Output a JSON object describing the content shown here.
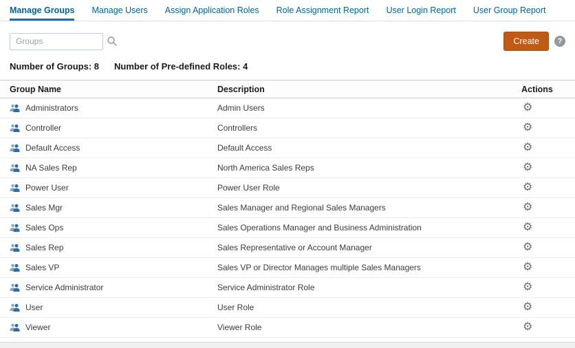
{
  "tabs": [
    {
      "label": "Manage Groups",
      "active": true
    },
    {
      "label": "Manage Users",
      "active": false
    },
    {
      "label": "Assign Application Roles",
      "active": false
    },
    {
      "label": "Role Assignment Report",
      "active": false
    },
    {
      "label": "User Login Report",
      "active": false
    },
    {
      "label": "User Group Report",
      "active": false
    }
  ],
  "toolbar": {
    "search_placeholder": "Groups",
    "create_label": "Create",
    "help_label": "?"
  },
  "summary": {
    "groups": "Number of Groups: 8",
    "roles": "Number of Pre-defined Roles: 4"
  },
  "table": {
    "columns": [
      "Group Name",
      "Description",
      "Actions"
    ],
    "rows": [
      {
        "name": "Administrators",
        "description": "Admin Users"
      },
      {
        "name": "Controller",
        "description": "Controllers"
      },
      {
        "name": "Default Access",
        "description": "Default Access"
      },
      {
        "name": "NA Sales Rep",
        "description": "North America Sales Reps"
      },
      {
        "name": "Power User",
        "description": "Power User Role"
      },
      {
        "name": "Sales Mgr",
        "description": "Sales Manager and Regional Sales Managers"
      },
      {
        "name": "Sales Ops",
        "description": "Sales Operations Manager and Business Administration"
      },
      {
        "name": "Sales Rep",
        "description": "Sales Representative or Account Manager"
      },
      {
        "name": "Sales VP",
        "description": "Sales VP or Director Manages multiple Sales Managers"
      },
      {
        "name": "Service Administrator",
        "description": "Service Administrator Role"
      },
      {
        "name": "User",
        "description": "User Role"
      },
      {
        "name": "Viewer",
        "description": "Viewer Role"
      }
    ]
  },
  "icons": {
    "row_icon": "group-icon",
    "action_icon": "gear-icon",
    "gear_glyph": "⚙"
  },
  "colors": {
    "tab_text": "#00639c",
    "active_tab_underline": "#0572ce",
    "create_button": "#c05b16",
    "group_icon_front": "#2e6da4",
    "group_icon_back": "#7fa8cf"
  }
}
